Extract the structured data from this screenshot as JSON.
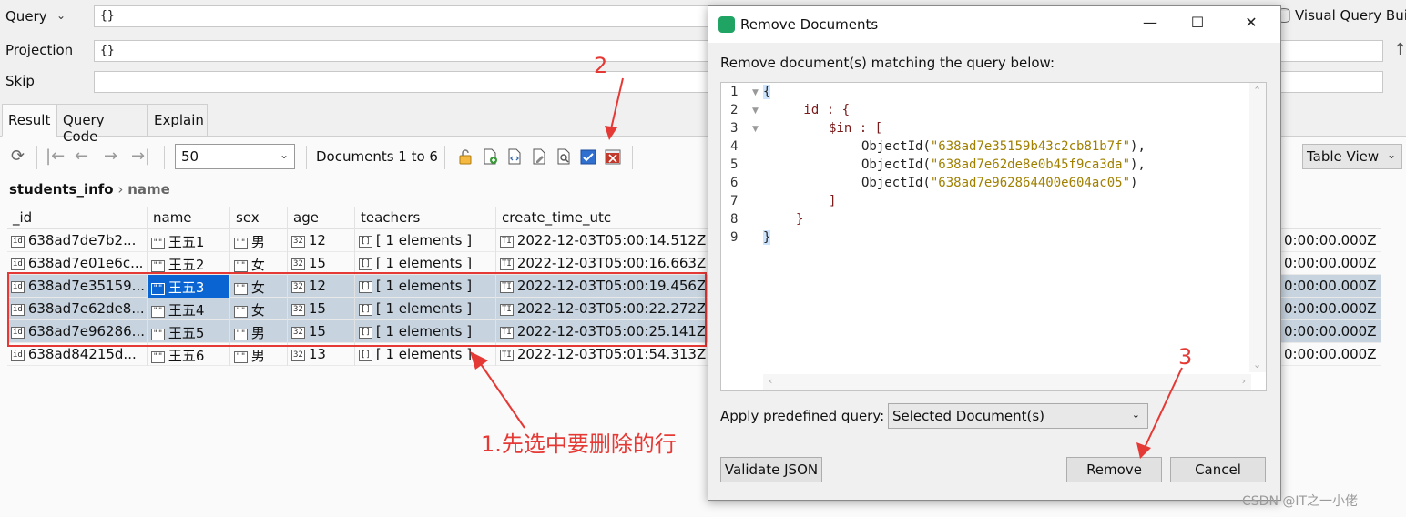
{
  "query": {
    "label": "Query",
    "value": "{}"
  },
  "projection": {
    "label": "Projection",
    "value": "{}"
  },
  "skip": {
    "label": "Skip",
    "value": ""
  },
  "visual_query_label": "Visual Query Bui",
  "tabs": [
    {
      "label": "Result"
    },
    {
      "label": "Query Code"
    },
    {
      "label": "Explain"
    }
  ],
  "toolbar": {
    "page_size": "50",
    "documents_label": "Documents 1 to 6",
    "view_mode": "Table View"
  },
  "breadcrumb": {
    "collection": "students_info",
    "field": "name"
  },
  "columns": [
    "_id",
    "name",
    "sex",
    "age",
    "teachers",
    "create_time_utc"
  ],
  "rows": [
    {
      "id": "638ad7de7b2...",
      "name": "王五1",
      "sex": "男",
      "age": "12",
      "teachers": "[ 1 elements ]",
      "created": "2022-12-03T05:00:14.512Z",
      "extra": "0:00:00.000Z",
      "selected": false
    },
    {
      "id": "638ad7e01e6c...",
      "name": "王五2",
      "sex": "女",
      "age": "15",
      "teachers": "[ 1 elements ]",
      "created": "2022-12-03T05:00:16.663Z",
      "extra": "0:00:00.000Z",
      "selected": false
    },
    {
      "id": "638ad7e35159...",
      "name": "王五3",
      "sex": "女",
      "age": "12",
      "teachers": "[ 1 elements ]",
      "created": "2022-12-03T05:00:19.456Z",
      "extra": "0:00:00.000Z",
      "selected": true
    },
    {
      "id": "638ad7e62de8...",
      "name": "王五4",
      "sex": "女",
      "age": "15",
      "teachers": "[ 1 elements ]",
      "created": "2022-12-03T05:00:22.272Z",
      "extra": "0:00:00.000Z",
      "selected": true
    },
    {
      "id": "638ad7e96286...",
      "name": "王五5",
      "sex": "男",
      "age": "15",
      "teachers": "[ 1 elements ]",
      "created": "2022-12-03T05:00:25.141Z",
      "extra": "0:00:00.000Z",
      "selected": true
    },
    {
      "id": "638ad84215d...",
      "name": "王五6",
      "sex": "男",
      "age": "13",
      "teachers": "[ 1 elements ]",
      "created": "2022-12-03T05:01:54.313Z",
      "extra": "0:00:00.000Z",
      "selected": false
    }
  ],
  "dialog": {
    "title": "Remove Documents",
    "prompt": "Remove document(s) matching the query below:",
    "line_numbers": [
      "1",
      "2",
      "3",
      "4",
      "5",
      "6",
      "7",
      "8",
      "9"
    ],
    "code": {
      "open": "{",
      "id_key": "_id",
      "in_key": "$in",
      "oid_fn": "ObjectId",
      "ids": [
        "\"638ad7e35159b43c2cb81b7f\"",
        "\"638ad7e62de8e0b45f9ca3da\"",
        "\"638ad7e962864400e604ac05\""
      ],
      "close": "}"
    },
    "apply_label": "Apply predefined query:",
    "apply_value": "Selected Document(s)",
    "validate_label": "Validate JSON",
    "remove_label": "Remove",
    "cancel_label": "Cancel"
  },
  "annotations": {
    "step1": "1.先选中要删除的行",
    "step2": "2",
    "step3": "3"
  },
  "watermark": "CSDN @IT之一小佬",
  "colors": {
    "annotation": "#e53935",
    "selection": "#c7d3df",
    "focus": "#0a64d2"
  }
}
